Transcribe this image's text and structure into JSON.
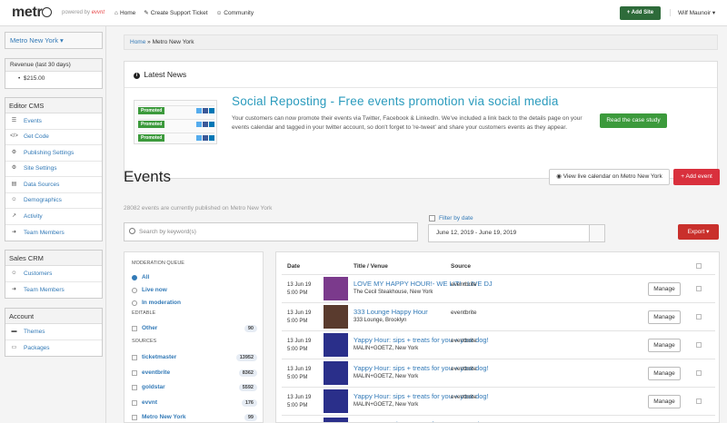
{
  "topbar": {
    "logo": "metr",
    "powered_by": "powered by",
    "brand": "evvnt",
    "nav": [
      {
        "icon": "⌂",
        "label": "Home"
      },
      {
        "icon": "✎",
        "label": "Create Support Ticket"
      },
      {
        "icon": "☺",
        "label": "Community"
      }
    ],
    "add_site": "+ Add Site",
    "user": "Wilf Maunoir ▾"
  },
  "sidebar": {
    "city": "Metro New York ▾",
    "revenue_header": "Revenue (last 30 days)",
    "revenue_value": "$215.00",
    "editor_cms": {
      "title": "Editor CMS",
      "items": [
        {
          "icon": "☰",
          "label": "Events"
        },
        {
          "icon": "</>",
          "label": "Get Code"
        },
        {
          "icon": "⚙",
          "label": "Publishing Settings"
        },
        {
          "icon": "⚙",
          "label": "Site Settings"
        },
        {
          "icon": "▤",
          "label": "Data Sources"
        },
        {
          "icon": "☺",
          "label": "Demographics"
        },
        {
          "icon": "↗",
          "label": "Activity"
        },
        {
          "icon": "➜",
          "label": "Team Members"
        }
      ]
    },
    "sales_crm": {
      "title": "Sales CRM",
      "items": [
        {
          "icon": "☺",
          "label": "Customers"
        },
        {
          "icon": "➜",
          "label": "Team Members"
        }
      ]
    },
    "account": {
      "title": "Account",
      "items": [
        {
          "icon": "▬",
          "label": "Themes"
        },
        {
          "icon": "▭",
          "label": "Packages"
        }
      ]
    }
  },
  "breadcrumb": {
    "home": "Home",
    "current": "Metro New York"
  },
  "news": {
    "title": "Latest News",
    "promo_tag": "Promoted",
    "headline": "Social Reposting - Free events promotion via social media",
    "body": "Your customers can now promote their events via Twitter, Facebook & LinkedIn. We've included a link back to the details page on your events calendar and tagged in your twitter account, so don't forget to 're-tweet' and share your customers events as they appear.",
    "cta": "Read the case study"
  },
  "events": {
    "title": "Events",
    "view_calendar": "View live calendar on Metro New York",
    "add_event": "+ Add event",
    "count_text": "28082 events are currently published on Metro New York",
    "search_placeholder": "Search by keyword(s)",
    "filter_by_date": "Filter by date",
    "date_range": "June 12, 2019  -  June 19, 2019",
    "export": "Export ▾"
  },
  "filters": {
    "moderation_label": "MODERATION QUEUE",
    "moderation": [
      {
        "label": "All",
        "on": true
      },
      {
        "label": "Live now",
        "on": false
      },
      {
        "label": "In moderation",
        "on": false
      }
    ],
    "editable_label": "EDITABLE",
    "editable": [
      {
        "label": "Other",
        "count": "90"
      }
    ],
    "sources_label": "SOURCES",
    "sources": [
      {
        "label": "ticketmaster",
        "count": "13952"
      },
      {
        "label": "eventbrite",
        "count": "8362"
      },
      {
        "label": "goldstar",
        "count": "5592"
      },
      {
        "label": "evvnt",
        "count": "176"
      },
      {
        "label": "Metro New York",
        "count": "99"
      }
    ]
  },
  "table": {
    "headers": {
      "date": "Date",
      "title": "Title / Venue",
      "source": "Source"
    },
    "rows": [
      {
        "date": "13 Jun 19",
        "time": "5:00 PM",
        "title": "LOVE MY HAPPY HOUR!- WE LIT! - LIVE DJ",
        "venue": "The Cecil Steakhouse, New York",
        "source": "eventbrite",
        "manage": "Manage",
        "thumb": "#7b3a8c"
      },
      {
        "date": "13 Jun 19",
        "time": "5:00 PM",
        "title": "333 Lounge Happy Hour",
        "venue": "333 Lounge, Brooklyn",
        "source": "eventbrite",
        "manage": "Manage",
        "thumb": "#5a3b2e"
      },
      {
        "date": "13 Jun 19",
        "time": "5:00 PM",
        "title": "Yappy Hour: sips + treats for you + your dog!",
        "venue": "MALIN+GOETZ, New York",
        "source": "eventbrite",
        "manage": "Manage",
        "thumb": "#2a2f8a"
      },
      {
        "date": "13 Jun 19",
        "time": "5:00 PM",
        "title": "Yappy Hour: sips + treats for you + your dog!",
        "venue": "MALIN+GOETZ, New York",
        "source": "eventbrite",
        "manage": "Manage",
        "thumb": "#2a2f8a"
      },
      {
        "date": "13 Jun 19",
        "time": "5:00 PM",
        "title": "Yappy Hour: sips + treats for you + your dog!",
        "venue": "MALIN+GOETZ, New York",
        "source": "eventbrite",
        "manage": "Manage",
        "thumb": "#2a2f8a"
      },
      {
        "date": "13 Jun 19",
        "time": "5:00 PM",
        "title": "Yappy Hour: sips + treats for you + your dog!",
        "venue": "MALIN+GOETZ, New York",
        "source": "eventbrite",
        "manage": "Manage",
        "thumb": "#2a2f8a"
      }
    ]
  }
}
